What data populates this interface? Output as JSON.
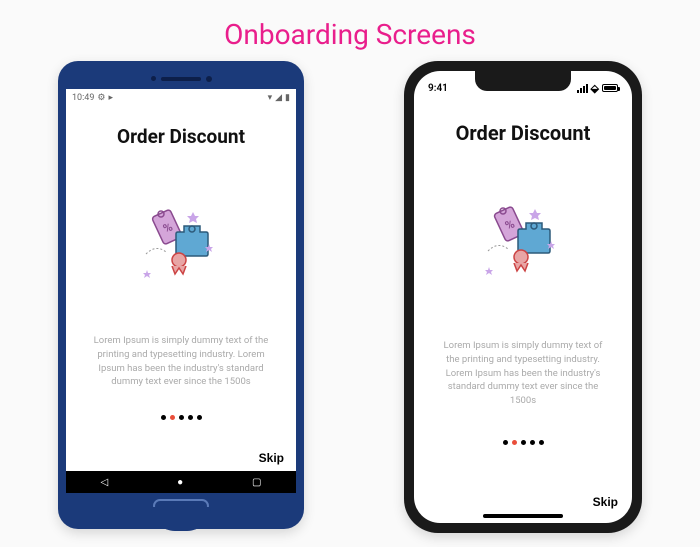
{
  "page_title": "Onboarding Screens",
  "android": {
    "status_time": "10:49",
    "screen_title": "Order Discount",
    "description": "Lorem Ipsum is simply dummy text of the printing and typesetting industry. Lorem Ipsum has been the industry's standard dummy text ever since the 1500s",
    "skip_label": "Skip",
    "active_dot": 1,
    "total_dots": 5
  },
  "iphone": {
    "status_time": "9:41",
    "screen_title": "Order Discount",
    "description": "Lorem Ipsum is simply dummy text of the printing and typesetting industry. Lorem Ipsum has been the industry's standard dummy text ever since the 1500s",
    "skip_label": "Skip",
    "active_dot": 1,
    "total_dots": 5
  },
  "colors": {
    "accent_pink": "#e91e8c",
    "accent_red": "#e94e3a",
    "android_frame": "#1b3a7a"
  }
}
